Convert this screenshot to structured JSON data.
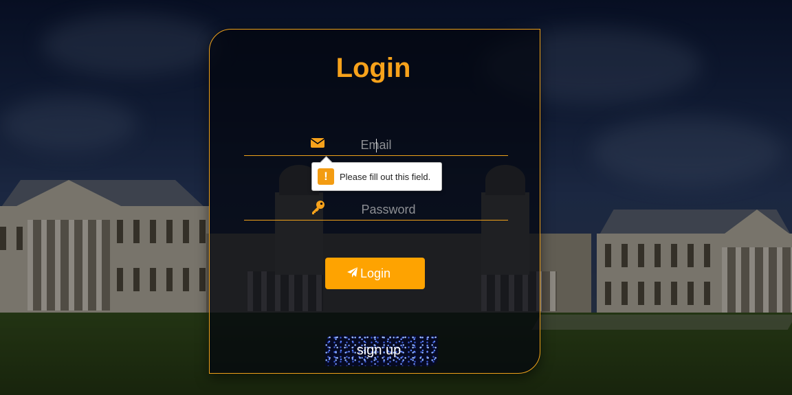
{
  "login_card": {
    "title": "Login",
    "email_field": {
      "placeholder": "Email",
      "value": "",
      "icon": "envelope-icon"
    },
    "password_field": {
      "placeholder": "Password",
      "value": "",
      "icon": "key-icon"
    },
    "validation_tooltip": {
      "message": "Please fill out this field.",
      "icon": "warning-icon"
    },
    "login_button": {
      "label": "Login",
      "icon": "paper-plane-icon"
    },
    "signup_button": {
      "label": "sign up"
    }
  },
  "colors": {
    "accent": "#f7a21b",
    "button": "#fea301",
    "card_background": "#03060e",
    "warning": "#f39c12"
  }
}
